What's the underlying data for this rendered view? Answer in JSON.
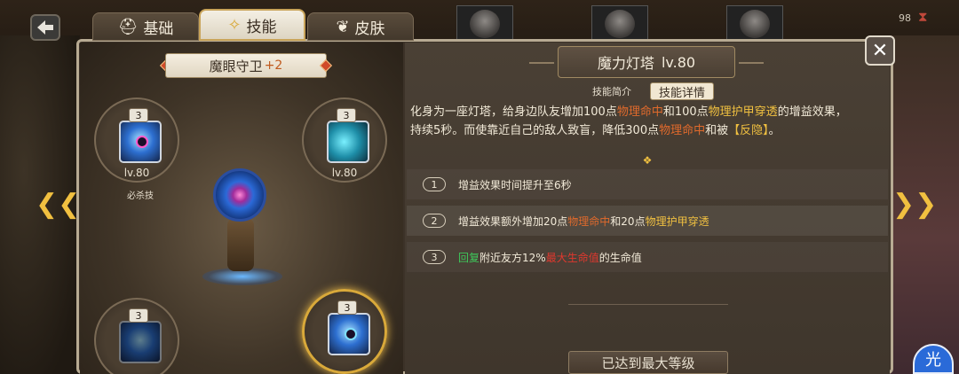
{
  "top_bar": {
    "tabs": [
      {
        "label": "基础",
        "icon": "helmet-icon"
      },
      {
        "label": "技能",
        "icon": "skill-icon"
      },
      {
        "label": "皮肤",
        "icon": "mask-icon"
      }
    ],
    "counter": "98"
  },
  "hero": {
    "name": "魔眼守卫",
    "bonus": "+2"
  },
  "skills": [
    {
      "badge": "3",
      "level": "lv.80",
      "tag": "必杀技"
    },
    {
      "badge": "3",
      "level": "lv.80",
      "tag": ""
    },
    {
      "badge": "3",
      "level": "",
      "tag": ""
    },
    {
      "badge": "3",
      "level": "",
      "tag": ""
    }
  ],
  "detail": {
    "skill_name": "魔力灯塔",
    "skill_level": "lv.80",
    "subtabs": [
      "技能简介",
      "技能详情"
    ],
    "description": {
      "p1": "化身为一座灯塔，给身边队友增加100点",
      "k1": "物理命中",
      "p2": "和100点",
      "k2": "物理护甲穿透",
      "p3": "的增益效果，",
      "p4": "持续5秒。而使靠近自己的敌人致盲，降低300点",
      "k3": "物理命中",
      "p5": "和被",
      "k4": "【反隐】",
      "p6": "。"
    },
    "bonuses": [
      {
        "num": "1",
        "text": "增益效果时间提升至6秒"
      },
      {
        "num": "2",
        "t1": "增益效果额外增加20点",
        "k1": "物理命中",
        "t2": "和20点",
        "k2": "物理护甲穿透"
      },
      {
        "num": "3",
        "k1": "回复",
        "t1": "附近友方12%",
        "k2": "最大生命值",
        "t2": "的生命值"
      }
    ],
    "max_level_label": "已达到最大等级"
  },
  "controls": {
    "close_label": "✕",
    "prev_label": "❮❮",
    "next_label": "❯❯",
    "round_button_label": "光"
  }
}
